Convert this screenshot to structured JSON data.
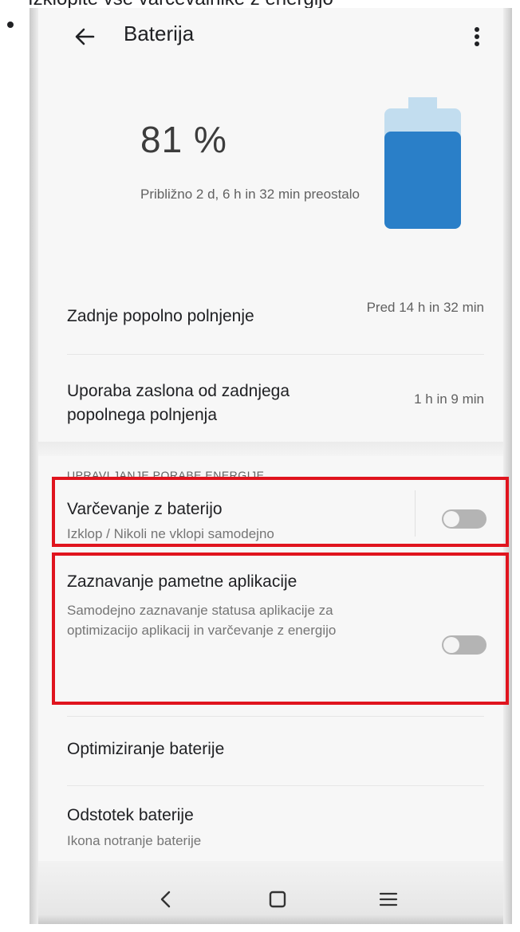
{
  "document": {
    "caption": "Izklopite vse varčevalnike z energijo"
  },
  "app_bar": {
    "title": "Baterija",
    "back_icon": "arrow-left-icon",
    "more_icon": "more-vert-icon"
  },
  "battery": {
    "percent_text": "81 %",
    "level_fraction": 0.81,
    "remaining_text": "Približno 2 d, 6 h in 32 min preostalo",
    "fill_color": "#2a7fc8",
    "cap_color": "#c2ddef"
  },
  "stats": [
    {
      "label": "Zadnje popolno polnjenje",
      "value": "Pred 14 h in 32 min"
    },
    {
      "label": "Uporaba zaslona od zadnjega popolnega polnjenja",
      "value": "1 h in 9 min"
    }
  ],
  "power_section": {
    "header": "UPRAVLJANJE PORABE ENERGIJE",
    "items": [
      {
        "title": "Varčevanje z baterijo",
        "subtitle": "Izklop / Nikoli ne vklopi samodejno",
        "toggle_on": false
      },
      {
        "title": "Zaznavanje pametne aplikacije",
        "subtitle": "Samodejno zaznavanje statusa aplikacije za optimizacijo aplikacij in varčevanje z energijo",
        "toggle_on": false
      },
      {
        "title": "Optimiziranje baterije"
      },
      {
        "title": "Odstotek baterije",
        "subtitle": "Ikona notranje baterije"
      }
    ]
  },
  "nav_bar": {
    "back_icon": "nav-back-icon",
    "home_icon": "nav-home-icon",
    "menu_icon": "nav-menu-icon"
  },
  "colors": {
    "highlight": "#e0141e",
    "toggle_off": "#b4b4b4"
  }
}
